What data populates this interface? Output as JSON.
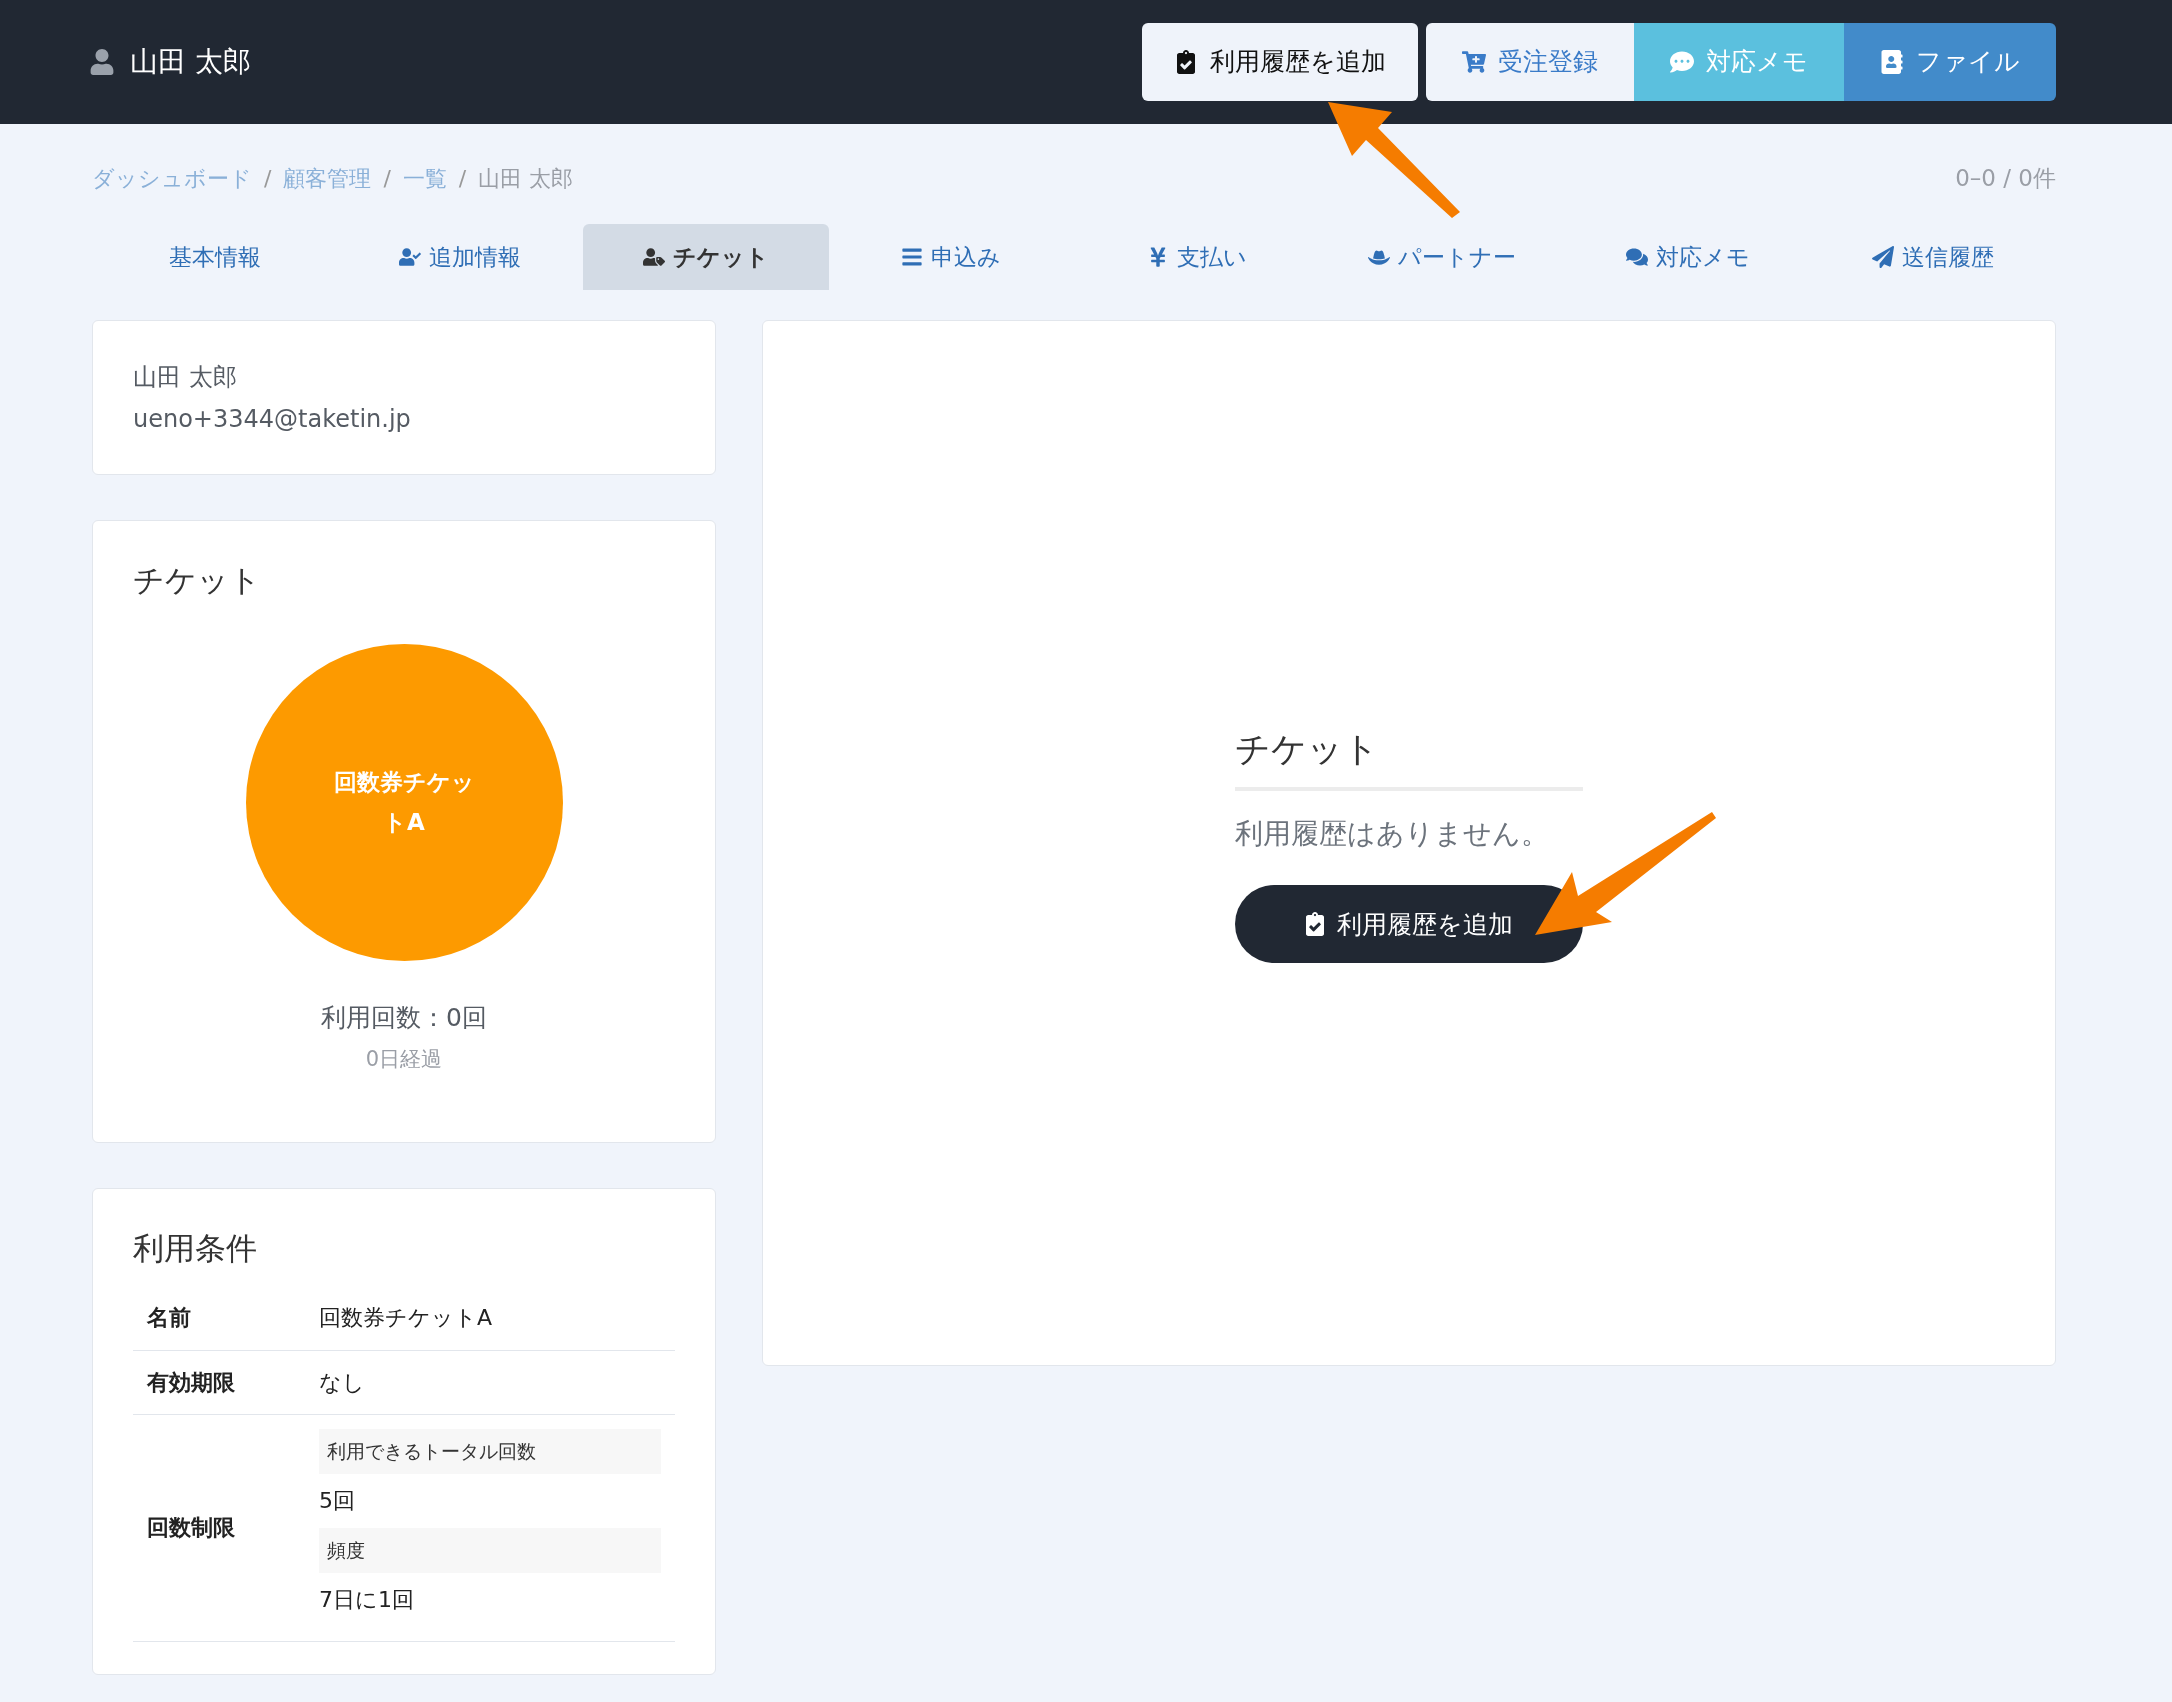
{
  "header": {
    "user_name": "山田 太郎",
    "buttons": [
      {
        "label": "利用履歴を追加",
        "kind": "light"
      },
      {
        "label": "受注登録",
        "kind": "link"
      },
      {
        "label": "対応メモ",
        "kind": "info"
      },
      {
        "label": "ファイル",
        "kind": "primary"
      }
    ]
  },
  "breadcrumb": [
    "ダッシュボード",
    "顧客管理",
    "一覧",
    "山田 太郎"
  ],
  "breadcrumb_separator": "/",
  "count": "0–0 / 0件",
  "tabs": [
    {
      "label": "基本情報",
      "selected": false
    },
    {
      "label": "追加情報",
      "selected": false
    },
    {
      "label": "チケット",
      "selected": true
    },
    {
      "label": "申込み",
      "selected": false
    },
    {
      "label": "支払い",
      "selected": false
    },
    {
      "label": "パートナー",
      "selected": false
    },
    {
      "label": "対応メモ",
      "selected": false
    },
    {
      "label": "送信履歴",
      "selected": false
    }
  ],
  "customer": {
    "name": "山田 太郎",
    "email": "ueno+3344@taketin.jp"
  },
  "ticket_card": {
    "title": "チケット",
    "ticket_name": "回数券チケットA",
    "color": "#fd9a00",
    "usage": "利用回数：0回",
    "elapsed": "0日経過"
  },
  "conditions": {
    "title": "利用条件",
    "rows": [
      {
        "label": "名前",
        "value": "回数券チケットA"
      },
      {
        "label": "有効期限",
        "value": "なし"
      },
      {
        "label": "回数制限",
        "sub": [
          {
            "label": "利用できるトータル回数",
            "value": "5回"
          },
          {
            "label": "頻度",
            "value": "7日に1回"
          }
        ]
      }
    ]
  },
  "history": {
    "title": "チケット",
    "empty_message": "利用履歴はありません。",
    "button": "利用履歴を追加"
  }
}
